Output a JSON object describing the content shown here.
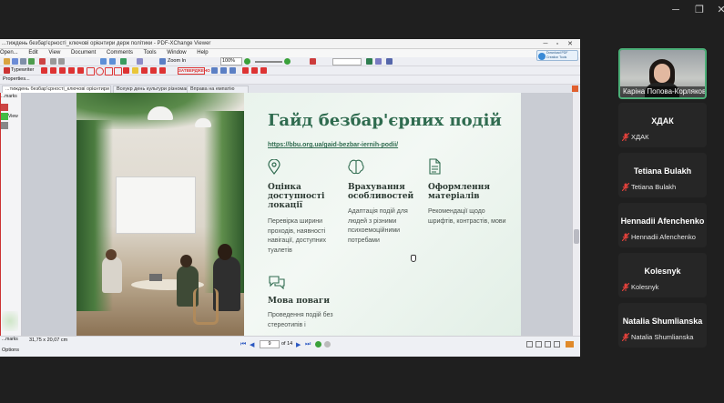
{
  "window": {
    "min_icon": "minimize-icon",
    "restore_icon": "restore-icon",
    "close_icon": "close-icon"
  },
  "app": {
    "title": "...тиждень безбар'єрності_ключові орієнтири держ політики - PDF-XChange Viewer",
    "menu": [
      "Open...",
      "Edit",
      "View",
      "Document",
      "Comments",
      "Tools",
      "Window",
      "Help"
    ],
    "zoom_label": "Zoom In",
    "zoom_value": "100%",
    "typewriter_label": "Typewriter",
    "properties_label": "Properties...",
    "stamp_label": "ЗАТВЕРДЖЕНО",
    "badge_text": "Download PDF Creation Tools",
    "tabs": [
      {
        "label": "...тиждень безбар'єрності_ключові орієнтири де...",
        "active": true
      },
      {
        "label": "Всеукр день культури різноманіття",
        "active": false
      },
      {
        "label": "Вправа на емпатію",
        "active": false
      }
    ],
    "left_panel": {
      "title": "...marks",
      "item": "View"
    },
    "status": {
      "page_size": "31,75 x 20,07 cm",
      "page_current": "9",
      "page_total": "of 14",
      "bottom_left": "Options",
      "bottom_left2": "...marks"
    }
  },
  "slide": {
    "title": "Гайд безбар'єрних подій",
    "link": "https://bbu.org.ua/gaid-bezbar-iernih-podii/",
    "features": [
      {
        "icon": "location-pin-icon",
        "title": "Оцінка доступності локації",
        "desc": "Перевірка ширини проходів, наявності навігації, доступних туалетів"
      },
      {
        "icon": "brain-icon",
        "title": "Врахування особливостей",
        "desc": "Адаптація подій для людей з різними психоемоційними потребами"
      },
      {
        "icon": "document-icon",
        "title": "Оформлення матеріалів",
        "desc": "Рекомендації щодо шрифтів, контрастів, мови"
      },
      {
        "icon": "chat-bubbles-icon",
        "title": "Мова поваги",
        "desc": "Проведення подій без стереотипів і"
      }
    ]
  },
  "participants": [
    {
      "name": "Каріна Попова-Корлякова",
      "video": true
    },
    {
      "name": "ХДАК",
      "label": "ХДАК",
      "muted": true
    },
    {
      "name": "Tetiana Bulakh",
      "label": "Tetiana Bulakh",
      "muted": true
    },
    {
      "name": "Hennadii Afenchenko",
      "label": "Hennadii Afenchenko",
      "muted": true
    },
    {
      "name": "Kolesnyk",
      "label": "Kolesnyk",
      "muted": true
    },
    {
      "name": "Natalia Shumlianska",
      "label": "Natalia Shumlianska",
      "muted": true
    }
  ],
  "colors": {
    "accent": "#2f6b4f",
    "meeting_bg": "#1f1f1f",
    "speaker_border": "#4caf78",
    "mute_red": "#e0413b"
  }
}
